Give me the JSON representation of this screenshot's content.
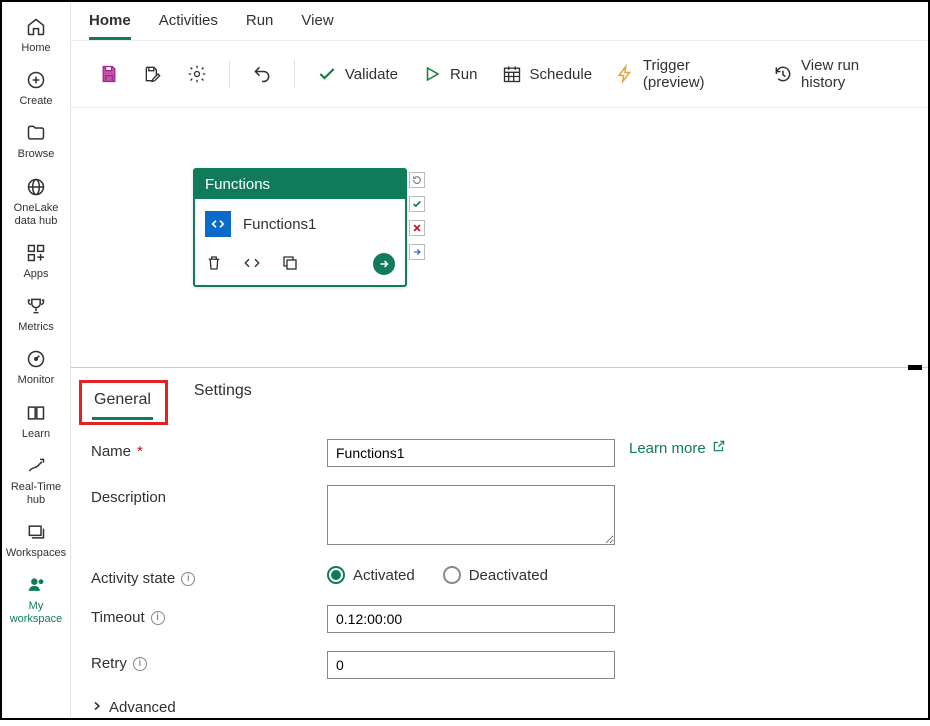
{
  "nav": {
    "items": [
      {
        "label": "Home"
      },
      {
        "label": "Create"
      },
      {
        "label": "Browse"
      },
      {
        "label": "OneLake data hub"
      },
      {
        "label": "Apps"
      },
      {
        "label": "Metrics"
      },
      {
        "label": "Monitor"
      },
      {
        "label": "Learn"
      },
      {
        "label": "Real-Time hub"
      },
      {
        "label": "Workspaces"
      },
      {
        "label": "My workspace"
      }
    ]
  },
  "toptabs": {
    "items": [
      {
        "label": "Home"
      },
      {
        "label": "Activities"
      },
      {
        "label": "Run"
      },
      {
        "label": "View"
      }
    ]
  },
  "toolbar": {
    "validate": "Validate",
    "run": "Run",
    "schedule": "Schedule",
    "trigger": "Trigger (preview)",
    "history": "View run history"
  },
  "activity": {
    "head": "Functions",
    "name": "Functions1"
  },
  "proptabs": {
    "general": "General",
    "settings": "Settings"
  },
  "form": {
    "name_label": "Name",
    "name_value": "Functions1",
    "learn_more": "Learn more",
    "desc_label": "Description",
    "desc_value": "",
    "state_label": "Activity state",
    "state_activated": "Activated",
    "state_deactivated": "Deactivated",
    "timeout_label": "Timeout",
    "timeout_value": "0.12:00:00",
    "retry_label": "Retry",
    "retry_value": "0",
    "advanced": "Advanced"
  }
}
